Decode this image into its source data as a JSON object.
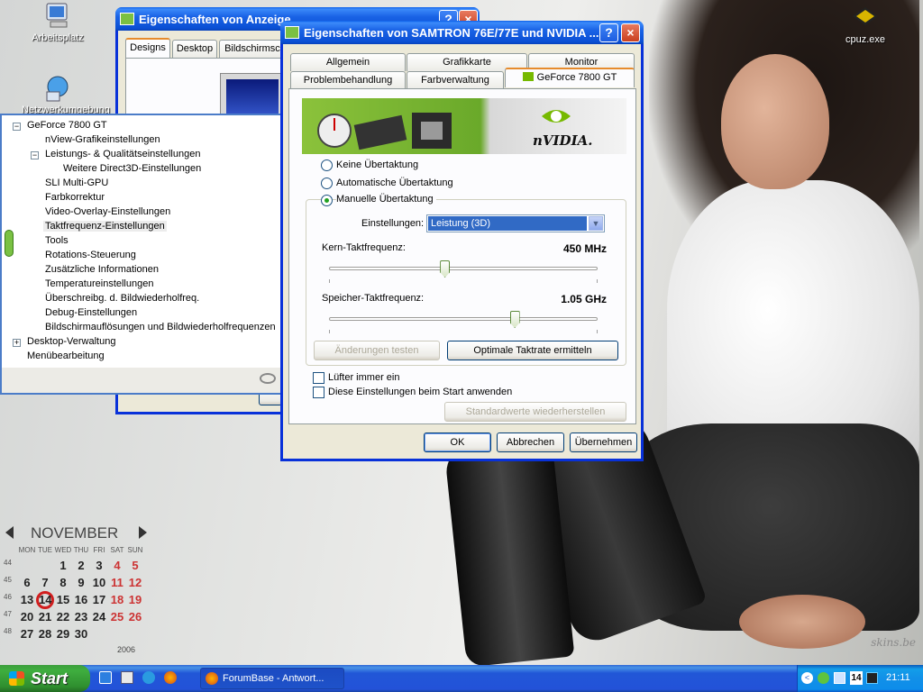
{
  "desktop": {
    "icons": [
      {
        "label": "Arbeitsplatz",
        "icon": "my-computer-icon"
      },
      {
        "label": "Netzwerkumgebung",
        "icon": "network-icon"
      },
      {
        "label": "cpuz.exe",
        "icon": "cpuz-icon"
      }
    ],
    "watermark": "skins.be"
  },
  "back_window": {
    "title": "Eigenschaften von Anzeige",
    "tabs": [
      "Designs",
      "Desktop",
      "Bildschirmsch"
    ]
  },
  "tree_panel": {
    "items": [
      {
        "label": "GeForce 7800 GT",
        "level": 0,
        "expander": "minus"
      },
      {
        "label": "nView-Grafikeinstellungen",
        "level": 1
      },
      {
        "label": "Leistungs- & Qualitätseinstellungen",
        "level": 1,
        "expander": "minus"
      },
      {
        "label": "Weitere Direct3D-Einstellungen",
        "level": 2
      },
      {
        "label": "SLI Multi-GPU",
        "level": 1
      },
      {
        "label": "Farbkorrektur",
        "level": 1
      },
      {
        "label": "Video-Overlay-Einstellungen",
        "level": 1
      },
      {
        "label": "Taktfrequenz-Einstellungen",
        "level": 1,
        "selected": true
      },
      {
        "label": "Tools",
        "level": 1
      },
      {
        "label": "Rotations-Steuerung",
        "level": 1
      },
      {
        "label": "Zusätzliche Informationen",
        "level": 1
      },
      {
        "label": "Temperatureinstellungen",
        "level": 1
      },
      {
        "label": "Überschreibg. d. Bildwiederholfreq.",
        "level": 1
      },
      {
        "label": "Debug-Einstellungen",
        "level": 1
      },
      {
        "label": "Bildschirmauflösungen und Bildwiederholfrequenzen",
        "level": 1
      },
      {
        "label": "Desktop-Verwaltung",
        "level": 0,
        "expander": "plus"
      },
      {
        "label": "Menübearbeitung",
        "level": 0
      }
    ]
  },
  "dialog": {
    "title": "Eigenschaften von SAMTRON 76E/77E und NVIDIA ...",
    "help_label": "?",
    "close_label": "×",
    "tabs_row1": [
      "Allgemein",
      "Grafikkarte",
      "Monitor"
    ],
    "tabs_row2": [
      "Problembehandlung",
      "Farbverwaltung",
      "GeForce 7800 GT"
    ],
    "banner_brand": "nVIDIA.",
    "radios": [
      {
        "label": "Keine Übertaktung",
        "checked": false
      },
      {
        "label": "Automatische Übertaktung",
        "checked": false
      },
      {
        "label": "Manuelle Übertaktung",
        "checked": true
      }
    ],
    "settings_label": "Einstellungen:",
    "settings_value": "Leistung (3D)",
    "core_label": "Kern-Taktfrequenz:",
    "core_value": "450 MHz",
    "core_slider_fraction": 0.43,
    "mem_label": "Speicher-Taktfrequenz:",
    "mem_value": "1.05 GHz",
    "mem_slider_fraction": 0.69,
    "test_button": "Änderungen testen",
    "optimal_button": "Optimale Taktrate ermitteln",
    "fan_checkbox": "Lüfter immer ein",
    "startup_checkbox": "Diese Einstellungen beim Start anwenden",
    "defaults_button": "Standardwerte wiederherstellen",
    "ok": "OK",
    "cancel": "Abbrechen",
    "apply": "Übernehmen"
  },
  "calendar": {
    "month": "NOVEMBER",
    "year": "2006",
    "weekdays": [
      "MON",
      "TUE",
      "WED",
      "THU",
      "FRI",
      "SAT",
      "SUN"
    ],
    "weeks": [
      {
        "wk": "44",
        "days": [
          "",
          "",
          "1",
          "2",
          "3",
          "4",
          "5"
        ]
      },
      {
        "wk": "45",
        "days": [
          "6",
          "7",
          "8",
          "9",
          "10",
          "11",
          "12"
        ]
      },
      {
        "wk": "46",
        "days": [
          "13",
          "14",
          "15",
          "16",
          "17",
          "18",
          "19"
        ]
      },
      {
        "wk": "47",
        "days": [
          "20",
          "21",
          "22",
          "23",
          "24",
          "25",
          "26"
        ]
      },
      {
        "wk": "48",
        "days": [
          "27",
          "28",
          "29",
          "30",
          "",
          "",
          ""
        ]
      }
    ],
    "today": "14"
  },
  "taskbar": {
    "start": "Start",
    "task_button": "ForumBase - Antwort...",
    "clock": "21:11",
    "tray_date": "14"
  },
  "colors": {
    "xp_blue": "#0831d9",
    "start_green": "#3fae3f",
    "weekend_red": "#cc3333",
    "tab_orange": "#e68b2c"
  }
}
